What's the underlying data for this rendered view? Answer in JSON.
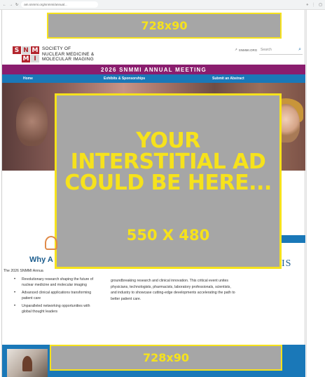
{
  "browser": {
    "url": "am.snmmi.org/snmmi/annual..."
  },
  "ads": {
    "top_label": "728x90",
    "interstitial_lines": [
      "YOUR",
      "INTERSTITIAL AD",
      "COULD BE HERE..."
    ],
    "interstitial_dims": "550 X 480",
    "bottom_label": "728x90",
    "ad_border_color": "#f6e21c",
    "ad_fill_color": "#a6a6a6"
  },
  "header": {
    "logo_letters": [
      "S",
      "N",
      "M",
      "",
      "M",
      "I"
    ],
    "logo_lines": [
      "SOCIETY OF",
      "NUCLEAR MEDICINE &",
      "MOLECULAR IMAGING"
    ],
    "snmmi_link": "SNMMI.ORG",
    "search_placeholder": "Search"
  },
  "meeting_band": {
    "title": "2026 SNMMI ANNUAL MEETING",
    "color": "#8a1d6e"
  },
  "nav": {
    "items": [
      "Home",
      "Exhibits & Sponsorships",
      "Submit an Abstract"
    ],
    "color": "#1a78b8"
  },
  "content": {
    "why_title": "Why A",
    "intro": "The 2026 SNMMI Annua",
    "bullets": [
      "Revolutionary research shaping the future of nuclear medicine and molecular imaging",
      "Advanced clinical applications transforming patient care",
      "Unparalleled networking opportunities with global thought leaders"
    ],
    "paragraph": "groundbreaking research and clinical innovation. This critical event unites physicians, technologists, pharmacists, laboratory professionals, scientists, and industry to showcase cutting-edge developments accelerating the path to better patient care.",
    "side_text": "IS"
  }
}
